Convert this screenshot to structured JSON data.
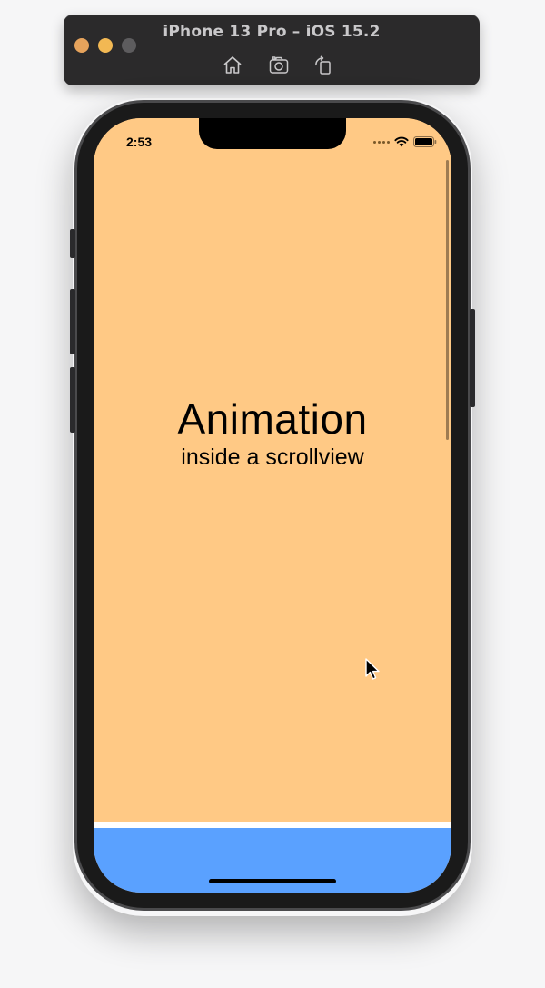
{
  "simulator": {
    "title": "iPhone 13 Pro – iOS 15.2",
    "toolbar": {
      "home_icon": "home-icon",
      "screenshot_icon": "camera-icon",
      "rotate_icon": "rotate-icon"
    }
  },
  "status_bar": {
    "time": "2:53",
    "icons": [
      "signal-dots",
      "wifi-icon",
      "battery-icon"
    ]
  },
  "main": {
    "title": "Animation",
    "subtitle": "inside a scrollview"
  },
  "colors": {
    "content_background": "#ffc985",
    "bottom_panel": "#5aa1ff",
    "divider_strip": "#ffffff"
  }
}
